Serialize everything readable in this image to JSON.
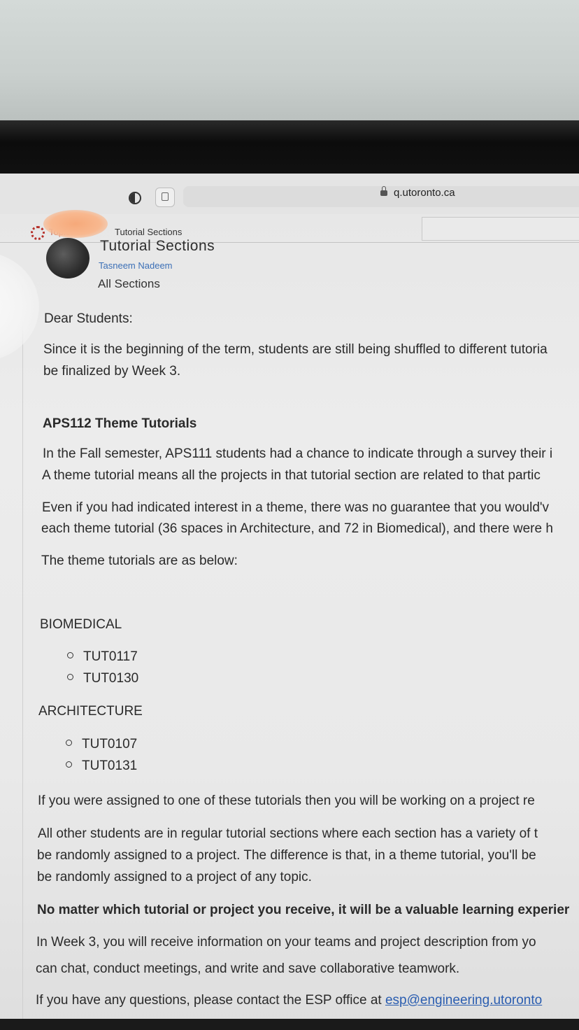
{
  "browser": {
    "url": "q.utoronto.ca",
    "shield_icon": "shield-icon",
    "reader_icon": "reader-view-icon",
    "lock_icon": "lock-icon"
  },
  "breadcrumb": {
    "topics": "Topics",
    "separator": "",
    "current": "Tutorial Sections"
  },
  "post": {
    "title": "Tutorial Sections",
    "author": "Tasneem Nadeem",
    "audience": "All Sections"
  },
  "body": {
    "greeting": "Dear Students:",
    "intro_1": "Since it is the beginning of the term, students are still being shuffled to different tutoria",
    "intro_2": "be finalized by Week 3.",
    "heading": "APS112 Theme Tutorials",
    "p1_1": "In the Fall semester, APS111 students had a chance to indicate through a survey their i",
    "p1_2": "A theme tutorial means all the projects in that tutorial section are related to that partic",
    "p2_1": "Even if you had indicated interest in a theme, there was no guarantee that you would'v",
    "p2_2": "each theme tutorial (36 spaces in Architecture, and 72 in Biomedical), and there were h",
    "p3": "The theme tutorials are as below:",
    "biomedical_heading": "BIOMEDICAL",
    "biomedical_items": [
      "TUT0117",
      "TUT0130"
    ],
    "architecture_heading": "ARCHITECTURE",
    "architecture_items": [
      "TUT0107",
      "TUT0131"
    ],
    "p4": "If you were assigned to one of these tutorials then you will be working on a project re",
    "p5_1": "All other students are in regular tutorial sections where each section has a variety of t",
    "p5_2": "be randomly assigned to a project. The difference is that, in a theme tutorial, you'll be",
    "p5_3": "be randomly assigned to a project of any topic.",
    "p6": "No matter which tutorial or project you receive, it will be a valuable learning experier",
    "p7_1": "In Week 3, you will receive information on your teams and project description from yo",
    "p7_2": "can chat, conduct meetings, and write and save collaborative teamwork.",
    "p8_prefix": "If you have any questions, please contact the ESP office at ",
    "p8_email": "esp@engineering.utoronto"
  }
}
